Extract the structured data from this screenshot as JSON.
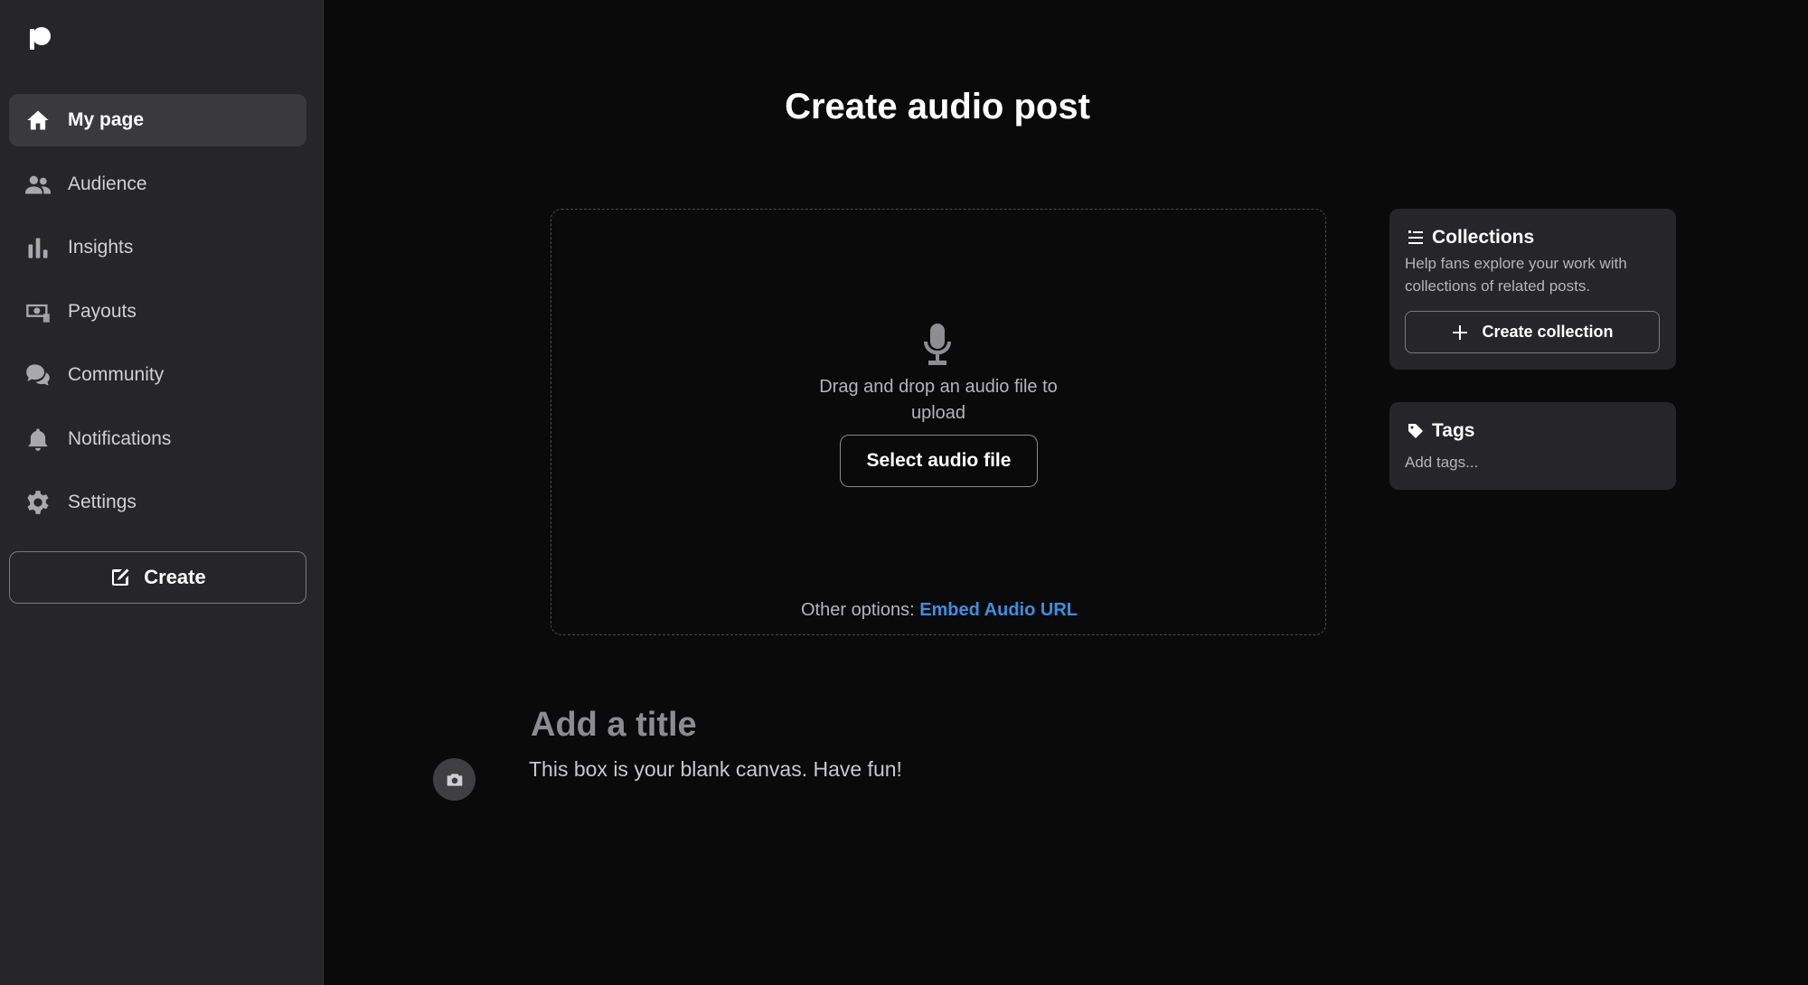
{
  "sidebar": {
    "logo_icon": "patreon-logo-icon",
    "items": [
      {
        "label": "My page",
        "icon": "home-icon",
        "active": true
      },
      {
        "label": "Audience",
        "icon": "people-icon",
        "active": false
      },
      {
        "label": "Insights",
        "icon": "bar-chart-icon",
        "active": false
      },
      {
        "label": "Payouts",
        "icon": "money-icon",
        "active": false
      },
      {
        "label": "Community",
        "icon": "chat-bubbles-icon",
        "active": false
      },
      {
        "label": "Notifications",
        "icon": "bell-icon",
        "active": false
      },
      {
        "label": "Settings",
        "icon": "gear-icon",
        "active": false
      }
    ],
    "create_label": "Create"
  },
  "main": {
    "title": "Create audio post",
    "dropzone": {
      "text": "Drag and drop an audio file to upload",
      "select_label": "Select audio file",
      "other_options_label": "Other options:",
      "embed_link": "Embed Audio URL"
    },
    "title_placeholder": "Add a title",
    "body_placeholder": "This box is your blank canvas. Have fun!"
  },
  "panels": {
    "collections": {
      "title": "Collections",
      "description": "Help fans explore your work with collections of related posts.",
      "button_label": "Create collection"
    },
    "tags": {
      "title": "Tags",
      "placeholder": "Add tags..."
    }
  },
  "colors": {
    "background": "#0a0a0b",
    "sidebar": "#262628",
    "link": "#3d8fe0"
  }
}
